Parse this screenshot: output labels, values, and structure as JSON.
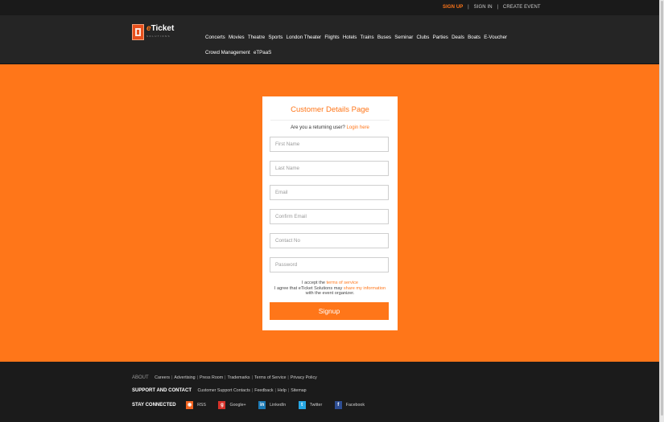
{
  "topbar": {
    "signup": "SIGN UP",
    "signin": "SIGN IN",
    "create_event": "CREATE EVENT",
    "separator": "|"
  },
  "logo": {
    "prefix": "e",
    "name": "Ticket",
    "tagline": "SOLUTIONS"
  },
  "nav": {
    "items": [
      "Concerts",
      "Movies",
      "Theatre",
      "Sports",
      "London Theater",
      "Flights",
      "Hotels",
      "Trains",
      "Buses",
      "Seminar",
      "Clubs",
      "Parties",
      "Deals",
      "Boats",
      "E-Voucher",
      "Crowd Management",
      "eTPaaS"
    ]
  },
  "form": {
    "title": "Customer Details Page",
    "returning_text": "Are you a returning user?",
    "login_link": "Login here",
    "fields": {
      "first_name": "First Name",
      "last_name": "Last Name",
      "email": "Email",
      "confirm_email": "Confirm Email",
      "contact_no": "Contact No",
      "password": "Password"
    },
    "terms_line1_pre": "I accept the",
    "terms_link": "terms of service",
    "terms_line2_pre": "I agree that eTicket Solutions may",
    "share_link": "share my information",
    "terms_line3": "with the event organizer.",
    "submit_label": "Signup"
  },
  "footer": {
    "about_label": "ABOUT",
    "about_links": [
      "Careers",
      "Advertising",
      "Press Room",
      "Trademarks",
      "Terms of Service",
      "Privacy Policy"
    ],
    "support_label": "SUPPORT AND CONTACT",
    "support_links": [
      "Customer Support Contacts",
      "Feedback",
      "Help",
      "Sitemap"
    ],
    "connected_label": "STAY CONNECTED",
    "social": [
      {
        "icon": "rss-icon",
        "label": "RSS"
      },
      {
        "icon": "google-plus-icon",
        "label": "Google+"
      },
      {
        "icon": "linkedin-icon",
        "label": "LinkedIn"
      },
      {
        "icon": "twitter-icon",
        "label": "Twitter"
      },
      {
        "icon": "facebook-icon",
        "label": "Facebook"
      }
    ]
  },
  "colors": {
    "accent": "#ff7619",
    "header_bg": "#252525",
    "topbar_bg": "#1a1a1a",
    "footer_bg": "#1b1b1b"
  }
}
